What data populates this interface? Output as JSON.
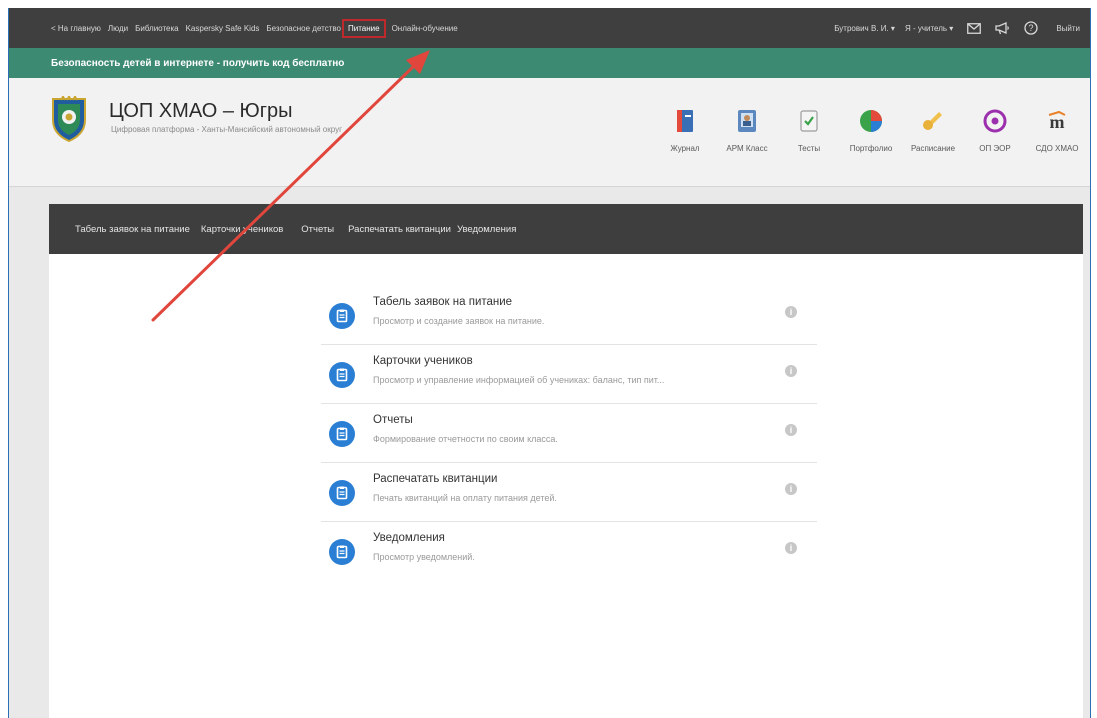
{
  "topnav": {
    "links": [
      "< На главную",
      "Люди",
      "Библиотека",
      "Kaspersky Safe Kids",
      "Безопасное детство",
      "Питание",
      "Онлайн-обучение"
    ],
    "active": "Питание",
    "user": "Бутрович В. И. ▾",
    "role": "Я - учитель ▾",
    "icons": [
      "mail-icon",
      "megaphone-icon",
      "help-icon"
    ],
    "logout": "Выйти"
  },
  "banner": {
    "text": "Безопасность детей в интернете - получить код бесплатно"
  },
  "header": {
    "title": "ЦОП ХМАО – Югры",
    "subtitle": "Цифровая платформа - Ханты-Мансийский автономный округ"
  },
  "apps": [
    {
      "label": "Журнал",
      "icon": "journal-icon"
    },
    {
      "label": "АРМ Класс",
      "icon": "class-icon"
    },
    {
      "label": "Тесты",
      "icon": "tests-icon"
    },
    {
      "label": "Портфолио",
      "icon": "portfolio-icon"
    },
    {
      "label": "Расписание",
      "icon": "schedule-icon"
    },
    {
      "label": "ОП ЭОР",
      "icon": "target-icon"
    },
    {
      "label": "СДО ХМАО",
      "icon": "moodle-icon"
    }
  ],
  "menubar": [
    "Табель заявок на питание",
    "Карточки учеников",
    "Отчеты",
    "Распечатать квитанции",
    "Уведомления"
  ],
  "items": [
    {
      "title": "Табель заявок на питание",
      "desc": "Просмотр и создание заявок на питание."
    },
    {
      "title": "Карточки учеников",
      "desc": "Просмотр и управление информацией об учениках: баланс, тип пит..."
    },
    {
      "title": "Отчеты",
      "desc": "Формирование отчетности по своим класса."
    },
    {
      "title": "Распечатать квитанции",
      "desc": "Печать квитанций на оплату питания детей."
    },
    {
      "title": "Уведомления",
      "desc": "Просмотр уведомлений."
    }
  ],
  "colors": {
    "topnav": "#3f3f3f",
    "banner": "#3c8a72",
    "menubar": "#3e3e3e",
    "accent": "#2a7fd4",
    "annotation": "#e0463c"
  }
}
